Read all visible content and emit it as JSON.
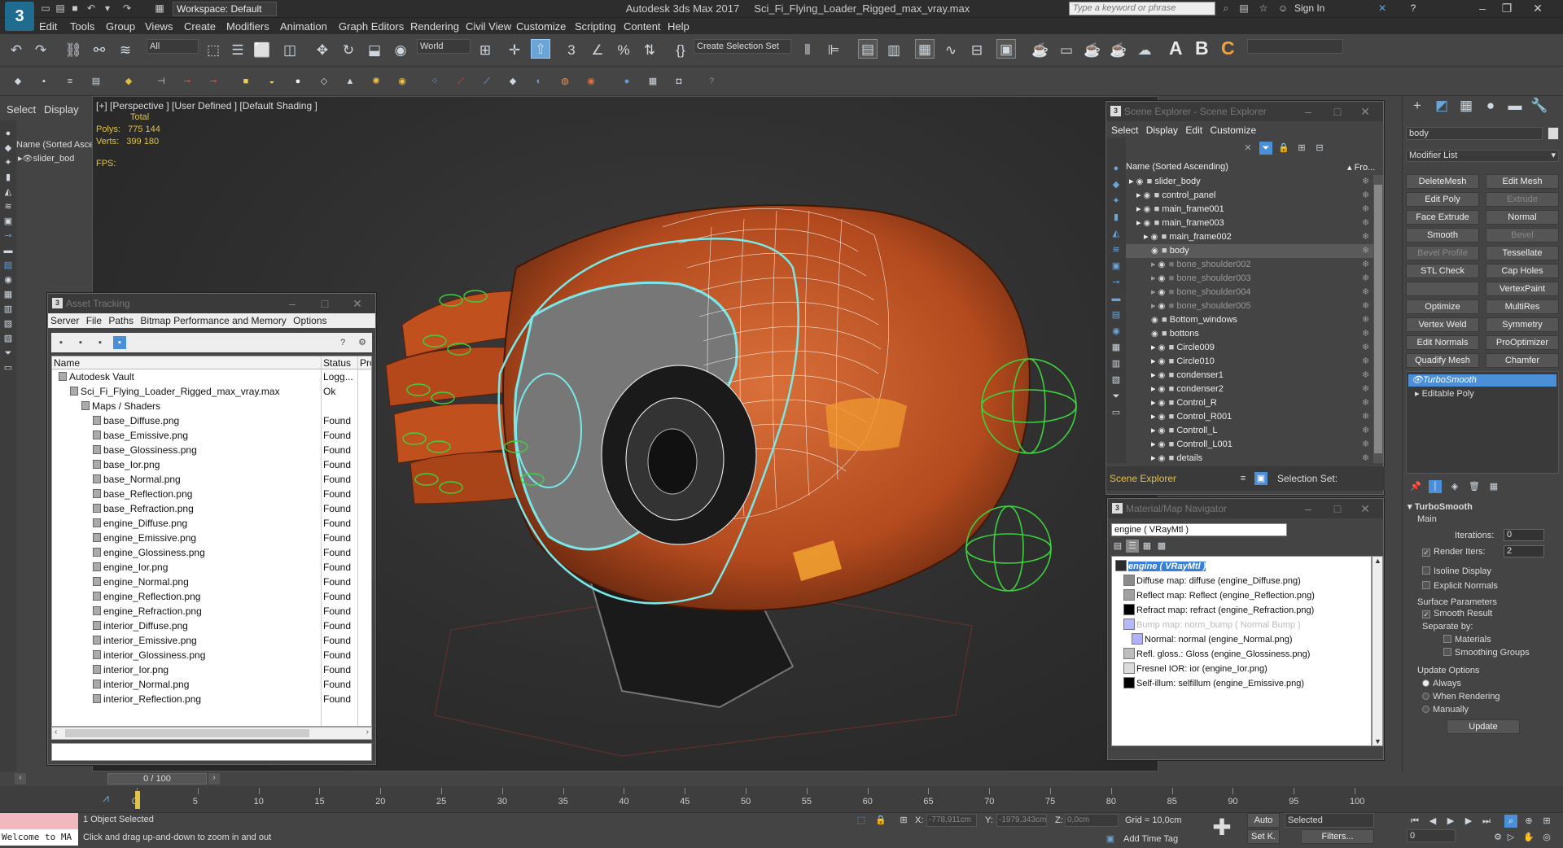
{
  "title": {
    "app_title": "Autodesk 3ds Max 2017",
    "file_name": "Sci_Fi_Flying_Loader_Rigged_max_vray.max",
    "workspace": "Workspace: Default",
    "search_placeholder": "Type a keyword or phrase",
    "sign_in": "Sign In"
  },
  "menu": [
    "Edit",
    "Tools",
    "Group",
    "Views",
    "Create",
    "Modifiers",
    "Animation",
    "Graph Editors",
    "Rendering",
    "Civil View",
    "Customize",
    "Scripting",
    "Content",
    "Help"
  ],
  "toolbar": {
    "filter": "All",
    "coord": "World",
    "selection_set": "Create Selection Set"
  },
  "left_panel": {
    "select": "Select",
    "display": "Display",
    "name_header": "Name (Sorted Asce",
    "item": "slider_bod"
  },
  "viewport": {
    "label": "[+] [Perspective ] [User Defined ] [Default Shading ]",
    "total": "Total",
    "polys_label": "Polys:",
    "polys_value": "775 144",
    "verts_label": "Verts:",
    "verts_value": "399 180",
    "fps_label": "FPS:"
  },
  "asset_tracking": {
    "title": "Asset Tracking",
    "menu": [
      "Server",
      "File",
      "Paths",
      "Bitmap Performance and Memory",
      "Options"
    ],
    "col_name": "Name",
    "col_status": "Status",
    "col_pro": "Pro",
    "rows": [
      {
        "name": "Autodesk Vault",
        "status": "Logg...",
        "indent": 0
      },
      {
        "name": "Sci_Fi_Flying_Loader_Rigged_max_vray.max",
        "status": "Ok",
        "indent": 1
      },
      {
        "name": "Maps / Shaders",
        "status": "",
        "indent": 2
      },
      {
        "name": "base_Diffuse.png",
        "status": "Found",
        "indent": 3
      },
      {
        "name": "base_Emissive.png",
        "status": "Found",
        "indent": 3
      },
      {
        "name": "base_Glossiness.png",
        "status": "Found",
        "indent": 3
      },
      {
        "name": "base_Ior.png",
        "status": "Found",
        "indent": 3
      },
      {
        "name": "base_Normal.png",
        "status": "Found",
        "indent": 3
      },
      {
        "name": "base_Reflection.png",
        "status": "Found",
        "indent": 3
      },
      {
        "name": "base_Refraction.png",
        "status": "Found",
        "indent": 3
      },
      {
        "name": "engine_Diffuse.png",
        "status": "Found",
        "indent": 3
      },
      {
        "name": "engine_Emissive.png",
        "status": "Found",
        "indent": 3
      },
      {
        "name": "engine_Glossiness.png",
        "status": "Found",
        "indent": 3
      },
      {
        "name": "engine_Ior.png",
        "status": "Found",
        "indent": 3
      },
      {
        "name": "engine_Normal.png",
        "status": "Found",
        "indent": 3
      },
      {
        "name": "engine_Reflection.png",
        "status": "Found",
        "indent": 3
      },
      {
        "name": "engine_Refraction.png",
        "status": "Found",
        "indent": 3
      },
      {
        "name": "interior_Diffuse.png",
        "status": "Found",
        "indent": 3
      },
      {
        "name": "interior_Emissive.png",
        "status": "Found",
        "indent": 3
      },
      {
        "name": "interior_Glossiness.png",
        "status": "Found",
        "indent": 3
      },
      {
        "name": "interior_Ior.png",
        "status": "Found",
        "indent": 3
      },
      {
        "name": "interior_Normal.png",
        "status": "Found",
        "indent": 3
      },
      {
        "name": "interior_Reflection.png",
        "status": "Found",
        "indent": 3
      }
    ]
  },
  "scene_explorer": {
    "title": "Scene Explorer - Scene Explorer",
    "menu": [
      "Select",
      "Display",
      "Edit",
      "Customize"
    ],
    "col_name": "Name (Sorted Ascending)",
    "col_fro": "▴ Fro...",
    "footer_label": "Scene Explorer",
    "selection_set": "Selection Set:",
    "rows": [
      {
        "name": "slider_body",
        "indent": 0,
        "gray": false,
        "sel": false
      },
      {
        "name": "control_panel",
        "indent": 1,
        "gray": false,
        "sel": false
      },
      {
        "name": "main_frame001",
        "indent": 1,
        "gray": false,
        "sel": false
      },
      {
        "name": "main_frame003",
        "indent": 1,
        "gray": false,
        "sel": false
      },
      {
        "name": "main_frame002",
        "indent": 2,
        "gray": false,
        "sel": false
      },
      {
        "name": "body",
        "indent": 3,
        "gray": false,
        "sel": true
      },
      {
        "name": "bone_shoulder002",
        "indent": 3,
        "gray": true,
        "sel": false
      },
      {
        "name": "bone_shoulder003",
        "indent": 3,
        "gray": true,
        "sel": false
      },
      {
        "name": "bone_shoulder004",
        "indent": 3,
        "gray": true,
        "sel": false
      },
      {
        "name": "bone_shoulder005",
        "indent": 3,
        "gray": true,
        "sel": false
      },
      {
        "name": "Bottom_windows",
        "indent": 3,
        "gray": false,
        "sel": false
      },
      {
        "name": "bottons",
        "indent": 3,
        "gray": false,
        "sel": false
      },
      {
        "name": "Circle009",
        "indent": 3,
        "gray": false,
        "sel": false
      },
      {
        "name": "Circle010",
        "indent": 3,
        "gray": false,
        "sel": false
      },
      {
        "name": "condenser1",
        "indent": 3,
        "gray": false,
        "sel": false
      },
      {
        "name": "condenser2",
        "indent": 3,
        "gray": false,
        "sel": false
      },
      {
        "name": "Control_R",
        "indent": 3,
        "gray": false,
        "sel": false
      },
      {
        "name": "Control_R001",
        "indent": 3,
        "gray": false,
        "sel": false
      },
      {
        "name": "Controll_L",
        "indent": 3,
        "gray": false,
        "sel": false
      },
      {
        "name": "Controll_L001",
        "indent": 3,
        "gray": false,
        "sel": false
      },
      {
        "name": "details",
        "indent": 3,
        "gray": false,
        "sel": false
      }
    ]
  },
  "material_nav": {
    "title": "Material/Map Navigator",
    "field": "engine  ( VRayMtl )",
    "rows": [
      {
        "text": "engine  ( VRayMtl )",
        "color": "#2b2b2b",
        "hl": true
      },
      {
        "text": "Diffuse map: diffuse (engine_Diffuse.png)",
        "color": "#8a8a8a",
        "hl": false
      },
      {
        "text": "Reflect map: Reflect (engine_Reflection.png)",
        "color": "#a0a0a0",
        "hl": false
      },
      {
        "text": "Refract map: refract (engine_Refraction.png)",
        "color": "#000000",
        "hl": false
      },
      {
        "text": "Bump map: norm_bump  ( Normal Bump )",
        "color": "#b7b7ff",
        "hl": false,
        "dim": true
      },
      {
        "text": "Normal: normal (engine_Normal.png)",
        "color": "#b0b0ff",
        "hl": false
      },
      {
        "text": "Refl. gloss.: Gloss (engine_Glossiness.png)",
        "color": "#bdbdbd",
        "hl": false
      },
      {
        "text": "Fresnel IOR: ior (engine_Ior.png)",
        "color": "#dcdcdc",
        "hl": false
      },
      {
        "text": "Self-illum: selfillum (engine_Emissive.png)",
        "color": "#000000",
        "hl": false
      }
    ]
  },
  "command_panel": {
    "object_name": "body",
    "modifier_list": "Modifier List",
    "buttons": [
      {
        "label": "DeleteMesh",
        "dim": false
      },
      {
        "label": "Edit Mesh",
        "dim": false
      },
      {
        "label": "Edit Poly",
        "dim": false
      },
      {
        "label": "Extrude",
        "dim": true
      },
      {
        "label": "Face Extrude",
        "dim": false
      },
      {
        "label": "Normal",
        "dim": false
      },
      {
        "label": "Smooth",
        "dim": false
      },
      {
        "label": "Bevel",
        "dim": true
      },
      {
        "label": "Bevel Profile",
        "dim": true
      },
      {
        "label": "Tessellate",
        "dim": false
      },
      {
        "label": "STL Check",
        "dim": false
      },
      {
        "label": "Cap Holes",
        "dim": false
      },
      {
        "label": "",
        "dim": false
      },
      {
        "label": "VertexPaint",
        "dim": false
      },
      {
        "label": "Optimize",
        "dim": false
      },
      {
        "label": "MultiRes",
        "dim": false
      },
      {
        "label": "Vertex Weld",
        "dim": false
      },
      {
        "label": "Symmetry",
        "dim": false
      },
      {
        "label": "Edit Normals",
        "dim": false
      },
      {
        "label": "ProOptimizer",
        "dim": false
      },
      {
        "label": "Quadify Mesh",
        "dim": false
      },
      {
        "label": "Chamfer",
        "dim": false
      }
    ],
    "stack": [
      "TurboSmooth",
      "Editable Poly"
    ],
    "rollout_title": "TurboSmooth",
    "main": "Main",
    "iterations_label": "Iterations:",
    "iterations_value": "0",
    "render_iters_label": "Render Iters:",
    "render_iters_value": "2",
    "isoline": "Isoline Display",
    "explicit": "Explicit Normals",
    "surface_params": "Surface Parameters",
    "smooth_result": "Smooth Result",
    "separate_by": "Separate by:",
    "materials": "Materials",
    "smoothing_groups": "Smoothing Groups",
    "update_options": "Update Options",
    "always": "Always",
    "when_rendering": "When Rendering",
    "manually": "Manually",
    "update": "Update"
  },
  "timeline": {
    "frame": "0 / 100",
    "ticks": [
      "0",
      "5",
      "10",
      "15",
      "20",
      "25",
      "30",
      "35",
      "40",
      "45",
      "50",
      "55",
      "60",
      "65",
      "70",
      "75",
      "80",
      "85",
      "90",
      "95",
      "100"
    ]
  },
  "status": {
    "listener": "Welcome to MA",
    "selected": "1 Object Selected",
    "hint": "Click and drag up-and-down to zoom in and out",
    "x_label": "X:",
    "x_value": "-778,911cm",
    "y_label": "Y:",
    "y_value": "-1979,343cm",
    "z_label": "Z:",
    "z_value": "0,0cm",
    "grid": "Grid = 10,0cm",
    "add_time_tag": "Add Time Tag",
    "auto": "Auto",
    "set_k": "Set K.",
    "selected_dd": "Selected",
    "filters": "Filters...",
    "frame_field": "0"
  }
}
